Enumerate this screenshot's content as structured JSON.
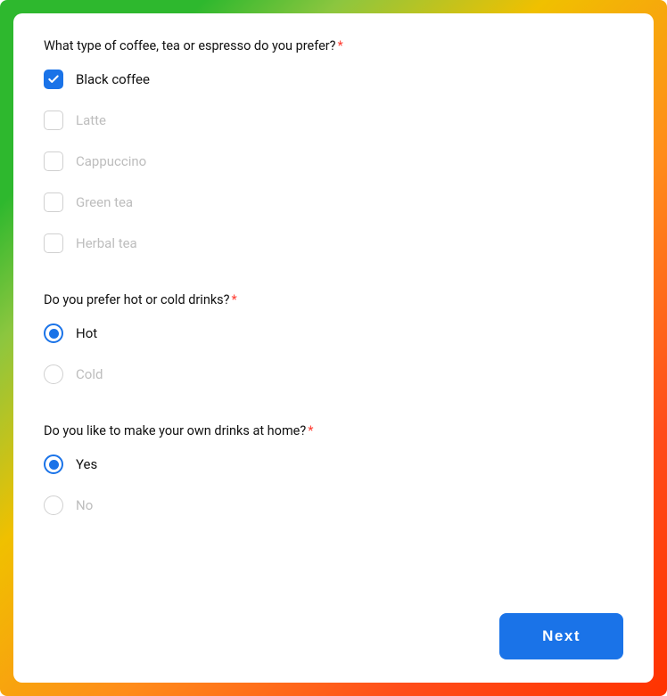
{
  "questions": [
    {
      "title": "What type of coffee, tea or espresso do you prefer?",
      "required": true,
      "type": "checkbox",
      "options": [
        {
          "label": "Black coffee",
          "selected": true
        },
        {
          "label": "Latte",
          "selected": false
        },
        {
          "label": "Cappuccino",
          "selected": false
        },
        {
          "label": "Green tea",
          "selected": false
        },
        {
          "label": "Herbal tea",
          "selected": false
        }
      ]
    },
    {
      "title": "Do you prefer hot or cold drinks?",
      "required": true,
      "type": "radio",
      "options": [
        {
          "label": "Hot",
          "selected": true
        },
        {
          "label": "Cold",
          "selected": false
        }
      ]
    },
    {
      "title": "Do you like to make your own drinks at home?",
      "required": true,
      "type": "radio",
      "options": [
        {
          "label": "Yes",
          "selected": true
        },
        {
          "label": "No",
          "selected": false
        }
      ]
    }
  ],
  "footer": {
    "next_label": "Next"
  }
}
